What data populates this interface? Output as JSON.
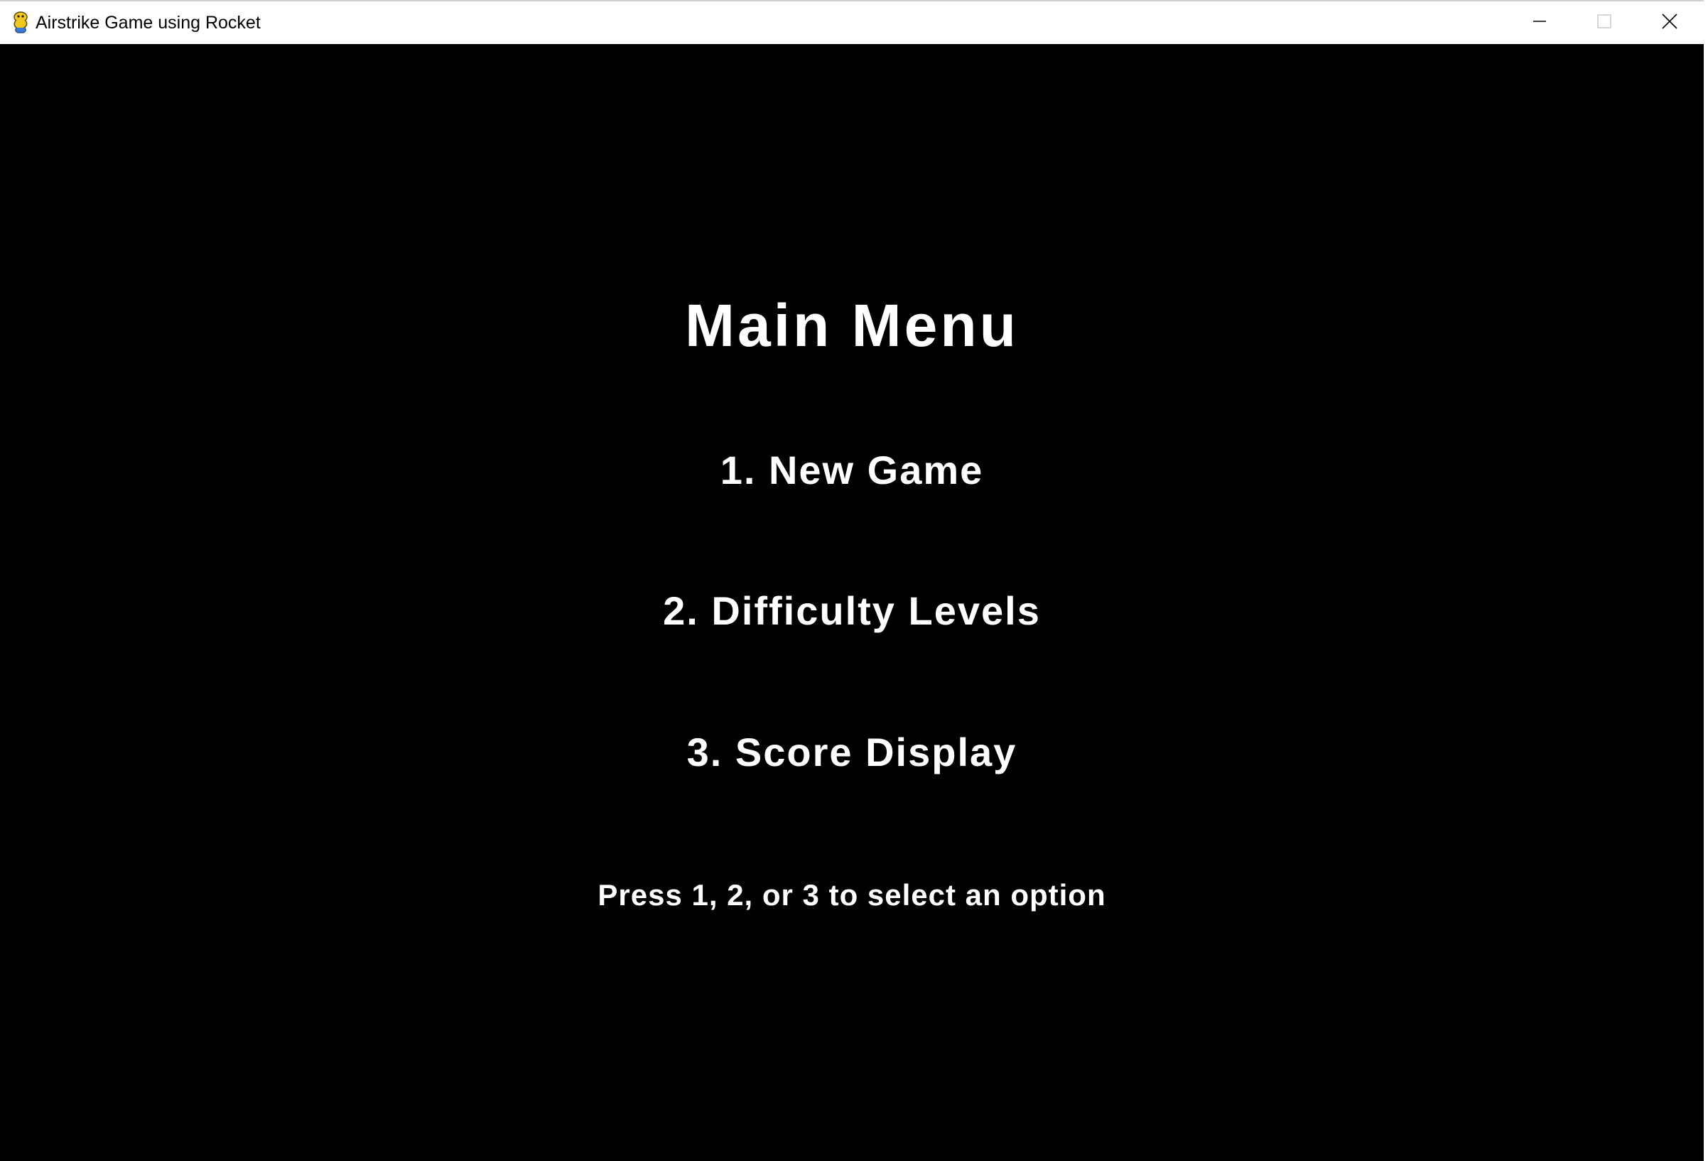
{
  "window": {
    "title": "Airstrike Game using Rocket",
    "icon": "pygame-snake-icon",
    "controls": [
      "minimize-icon",
      "maximize-icon",
      "close-icon"
    ]
  },
  "menu": {
    "title": "Main Menu",
    "options": [
      "1. New Game",
      "2. Difficulty Levels",
      "3. Score Display"
    ],
    "hint": "Press 1, 2, or 3 to select an option"
  },
  "colors": {
    "background": "#000000",
    "text": "#ffffff",
    "titlebar": "#ffffff"
  }
}
